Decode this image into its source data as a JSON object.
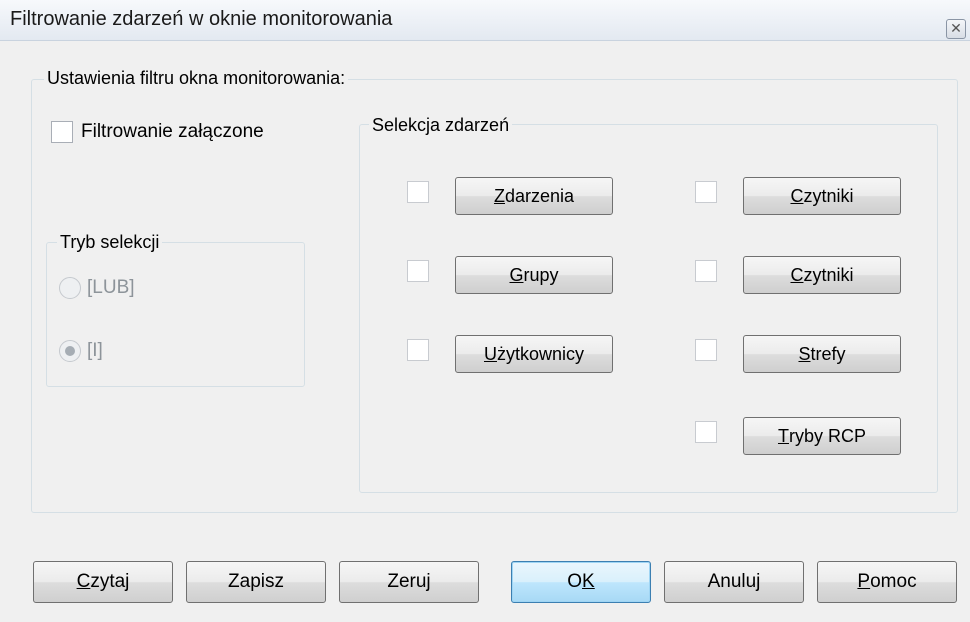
{
  "window": {
    "title": "Filtrowanie zdarzeń w oknie monitorowania",
    "close_glyph": "✕"
  },
  "settings": {
    "group_label": "Ustawienia filtru okna monitorowania:",
    "filter_enabled": {
      "label": "Filtrowanie załączone",
      "checked": false
    }
  },
  "selection_mode": {
    "group_label": "Tryb selekcji",
    "options": [
      {
        "label": "[LUB]",
        "selected": false
      },
      {
        "label": "[I]",
        "selected": true
      }
    ]
  },
  "event_selection": {
    "group_label": "Selekcja zdarzeń",
    "items": [
      {
        "mnemonic": "Z",
        "rest": "darzenia",
        "checked": false
      },
      {
        "mnemonic": "G",
        "rest": "rupy",
        "checked": false
      },
      {
        "mnemonic": "U",
        "rest": "żytkownicy",
        "checked": false
      },
      {
        "mnemonic": "C",
        "rest": "zytniki",
        "checked": false
      },
      {
        "mnemonic": "C",
        "rest": "zytniki",
        "checked": false
      },
      {
        "mnemonic": "S",
        "rest": "trefy",
        "checked": false
      },
      {
        "mnemonic": "T",
        "rest": "ryby RCP",
        "checked": false
      }
    ]
  },
  "footer": {
    "read": {
      "mnemonic": "C",
      "rest": "zytaj"
    },
    "save": {
      "label": "Zapisz"
    },
    "reset": {
      "label": "Zeruj"
    },
    "ok": {
      "pre": "O",
      "mnemonic": "K"
    },
    "cancel": {
      "label": "Anuluj"
    },
    "help": {
      "mnemonic": "P",
      "rest": "omoc"
    }
  }
}
